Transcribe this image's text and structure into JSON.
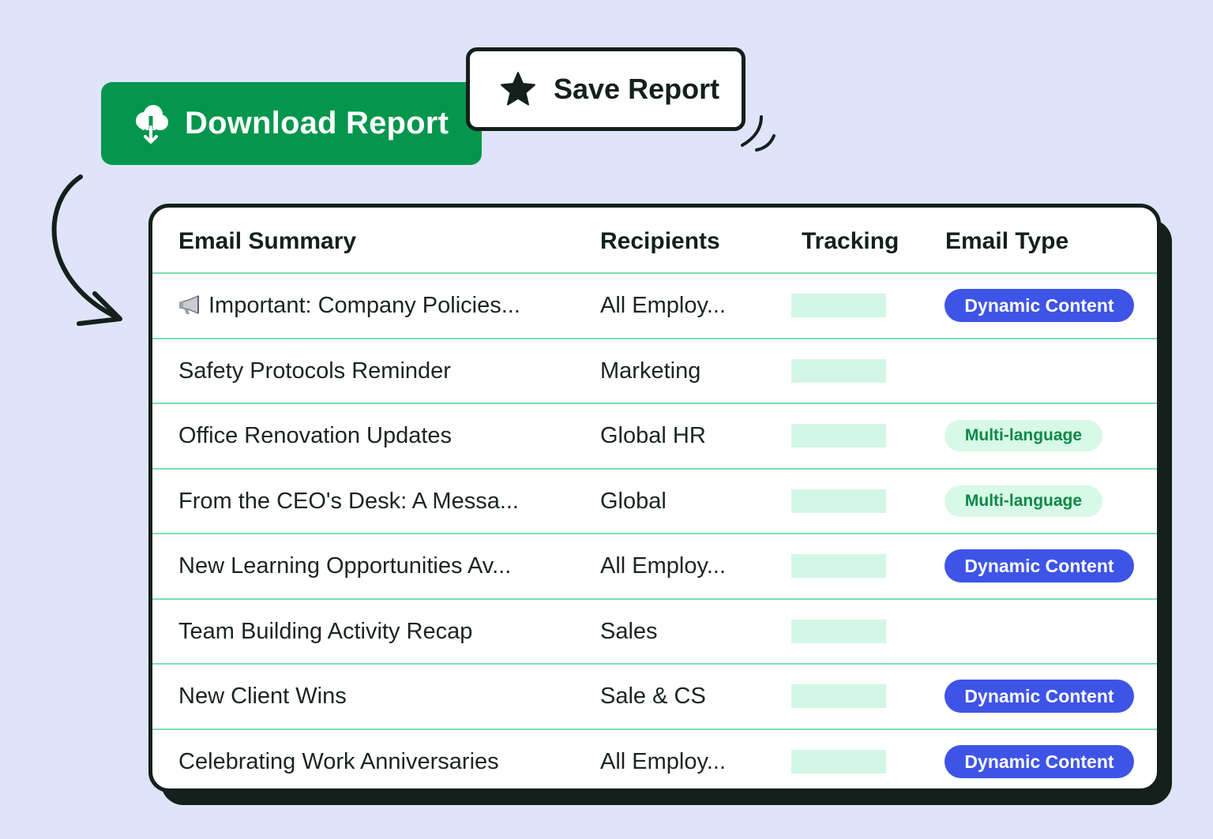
{
  "actions": {
    "download_label": "Download Report",
    "save_label": "Save Report"
  },
  "table": {
    "headers": {
      "summary": "Email Summary",
      "recipients": "Recipients",
      "tracking": "Tracking",
      "type": "Email Type"
    },
    "rows": [
      {
        "summary": "Important: Company Policies...",
        "recipients": "All Employ...",
        "type": "Dynamic Content"
      },
      {
        "summary": "Safety Protocols Reminder",
        "recipients": "Marketing",
        "type": ""
      },
      {
        "summary": "Office Renovation Updates",
        "recipients": "Global HR",
        "type": "Multi-language"
      },
      {
        "summary": "From the CEO's Desk: A Messa...",
        "recipients": "Global",
        "type": "Multi-language"
      },
      {
        "summary": "New Learning Opportunities Av...",
        "recipients": "All Employ...",
        "type": "Dynamic Content"
      },
      {
        "summary": "Team Building Activity Recap",
        "recipients": "Sales",
        "type": ""
      },
      {
        "summary": "New Client Wins",
        "recipients": "Sale & CS",
        "type": "Dynamic Content"
      },
      {
        "summary": "Celebrating Work Anniversaries",
        "recipients": "All Employ...",
        "type": "Dynamic Content"
      }
    ]
  },
  "icons": {
    "download": "cloud-download-icon",
    "save": "star-icon",
    "first_row": "megaphone-icon"
  },
  "colors": {
    "background": "#dfe4fb",
    "download_button": "#03964c",
    "dynamic_badge": "#3e54e6",
    "multi_badge_bg": "#d8f8e8",
    "multi_badge_text": "#0a8a46",
    "row_divider": "#7be0b3",
    "tracking_bar": "#d3f7e7"
  }
}
